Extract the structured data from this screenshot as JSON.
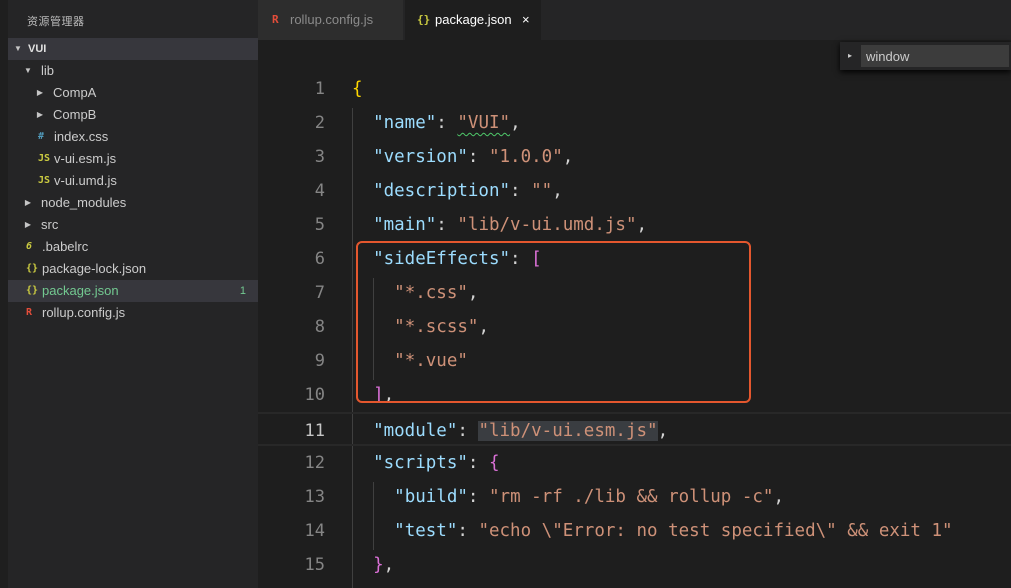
{
  "explorer": {
    "title": "资源管理器",
    "root": "VUI",
    "items": [
      {
        "label": "lib",
        "kind": "folder-open"
      },
      {
        "label": "CompA",
        "kind": "folder"
      },
      {
        "label": "CompB",
        "kind": "folder"
      },
      {
        "label": "index.css",
        "kind": "css-file",
        "icon": "#"
      },
      {
        "label": "v-ui.esm.js",
        "kind": "js-file",
        "icon": "JS"
      },
      {
        "label": "v-ui.umd.js",
        "kind": "js-file",
        "icon": "JS"
      },
      {
        "label": "node_modules",
        "kind": "folder"
      },
      {
        "label": "src",
        "kind": "folder"
      },
      {
        "label": ".babelrc",
        "kind": "babel-file",
        "icon": "6"
      },
      {
        "label": "package-lock.json",
        "kind": "json-file",
        "icon": "{}"
      },
      {
        "label": "package.json",
        "kind": "json-file",
        "icon": "{}",
        "badge": "1",
        "selected": true
      },
      {
        "label": "rollup.config.js",
        "kind": "rollup-file",
        "icon": "R"
      }
    ]
  },
  "tabs": [
    {
      "label": "rollup.config.js",
      "icon": "R",
      "active": false
    },
    {
      "label": "package.json",
      "icon": "{}",
      "active": true,
      "close": "×"
    }
  ],
  "find": {
    "value": "window",
    "toggle": "▸"
  },
  "editor": {
    "current_line": 11,
    "lines": [
      {
        "n": "1",
        "tokens": [
          [
            "{",
            "br1"
          ]
        ]
      },
      {
        "n": "2",
        "tokens": [
          [
            "  ",
            "pun"
          ],
          [
            "\"name\"",
            "key"
          ],
          [
            ": ",
            "pun"
          ],
          [
            "\"VUI\"",
            "str",
            "squig"
          ],
          [
            ",",
            "pun"
          ]
        ]
      },
      {
        "n": "3",
        "tokens": [
          [
            "  ",
            "pun"
          ],
          [
            "\"version\"",
            "key"
          ],
          [
            ": ",
            "pun"
          ],
          [
            "\"1.0.0\"",
            "str"
          ],
          [
            ",",
            "pun"
          ]
        ]
      },
      {
        "n": "4",
        "tokens": [
          [
            "  ",
            "pun"
          ],
          [
            "\"description\"",
            "key"
          ],
          [
            ": ",
            "pun"
          ],
          [
            "\"\"",
            "str"
          ],
          [
            ",",
            "pun"
          ]
        ]
      },
      {
        "n": "5",
        "tokens": [
          [
            "  ",
            "pun"
          ],
          [
            "\"main\"",
            "key"
          ],
          [
            ": ",
            "pun"
          ],
          [
            "\"lib/v-ui.umd.js\"",
            "str"
          ],
          [
            ",",
            "pun"
          ]
        ]
      },
      {
        "n": "6",
        "tokens": [
          [
            "  ",
            "pun"
          ],
          [
            "\"sideEffects\"",
            "key"
          ],
          [
            ": ",
            "pun"
          ],
          [
            "[",
            "br2"
          ]
        ]
      },
      {
        "n": "7",
        "tokens": [
          [
            "    ",
            "pun"
          ],
          [
            "\"*.css\"",
            "str"
          ],
          [
            ",",
            "pun"
          ]
        ]
      },
      {
        "n": "8",
        "tokens": [
          [
            "    ",
            "pun"
          ],
          [
            "\"*.scss\"",
            "str"
          ],
          [
            ",",
            "pun"
          ]
        ]
      },
      {
        "n": "9",
        "tokens": [
          [
            "    ",
            "pun"
          ],
          [
            "\"*.vue\"",
            "str"
          ]
        ]
      },
      {
        "n": "10",
        "tokens": [
          [
            "  ",
            "pun"
          ],
          [
            "]",
            "br2"
          ],
          [
            ",",
            "pun"
          ]
        ]
      },
      {
        "n": "11",
        "tokens": [
          [
            "  ",
            "pun"
          ],
          [
            "\"module\"",
            "key"
          ],
          [
            ": ",
            "pun"
          ],
          [
            "\"lib/v-ui.esm.js\"",
            "str",
            "hl"
          ],
          [
            ",",
            "pun"
          ]
        ]
      },
      {
        "n": "12",
        "tokens": [
          [
            "  ",
            "pun"
          ],
          [
            "\"scripts\"",
            "key"
          ],
          [
            ": ",
            "pun"
          ],
          [
            "{",
            "br2"
          ]
        ]
      },
      {
        "n": "13",
        "tokens": [
          [
            "    ",
            "pun"
          ],
          [
            "\"build\"",
            "key"
          ],
          [
            ": ",
            "pun"
          ],
          [
            "\"rm -rf ./lib && rollup -c\"",
            "str"
          ],
          [
            ",",
            "pun"
          ]
        ]
      },
      {
        "n": "14",
        "tokens": [
          [
            "    ",
            "pun"
          ],
          [
            "\"test\"",
            "key"
          ],
          [
            ": ",
            "pun"
          ],
          [
            "\"echo \\\"Error: no test specified\\\" && exit 1\"",
            "str"
          ]
        ]
      },
      {
        "n": "15",
        "tokens": [
          [
            "  ",
            "pun"
          ],
          [
            "}",
            "br2"
          ],
          [
            ",",
            "pun"
          ]
        ]
      }
    ]
  },
  "colors": {
    "annotation_box": "#e4572e",
    "selected_file": "#73c991",
    "json_key": "#9cdcfe",
    "json_string": "#ce9178"
  }
}
